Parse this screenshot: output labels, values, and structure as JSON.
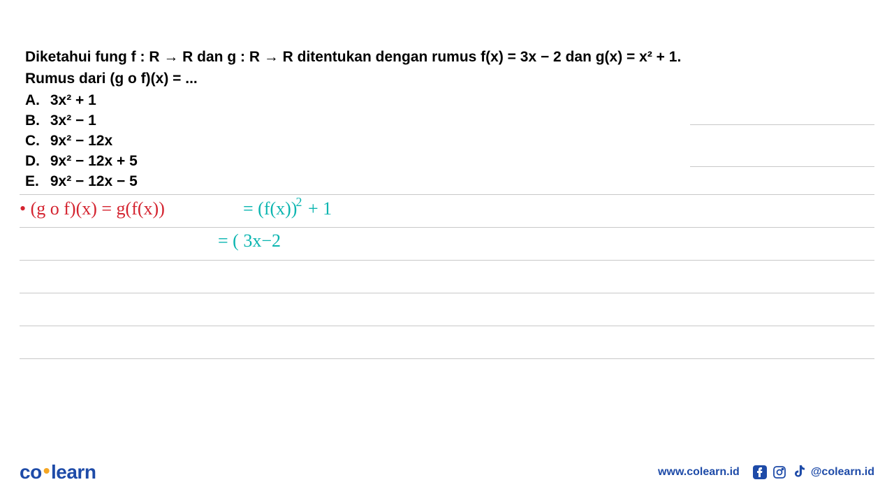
{
  "question": {
    "line1": "Diketahui fung f : R → R dan g : R → R ditentukan dengan rumus f(x) = 3x − 2 dan g(x) = x² + 1.",
    "line2": "Rumus dari (g o f)(x) = ..."
  },
  "options": [
    {
      "label": "A.",
      "text": "3x² + 1"
    },
    {
      "label": "B.",
      "text": "3x² − 1"
    },
    {
      "label": "C.",
      "text": "9x² − 12x"
    },
    {
      "label": "D.",
      "text": "9x² − 12x + 5"
    },
    {
      "label": "E.",
      "text": "9x² − 12x − 5"
    }
  ],
  "handwriting": {
    "red_part": "• (g o f)(x) = g(f(x))",
    "teal_part1_a": "= (f(x))",
    "teal_part1_sup": "2",
    "teal_part1_b": " + 1",
    "teal_part2": "= ( 3x−2"
  },
  "footer": {
    "logo_co": "co",
    "logo_dot": "•",
    "logo_learn": "learn",
    "url": "www.colearn.id",
    "handle": "@colearn.id"
  }
}
